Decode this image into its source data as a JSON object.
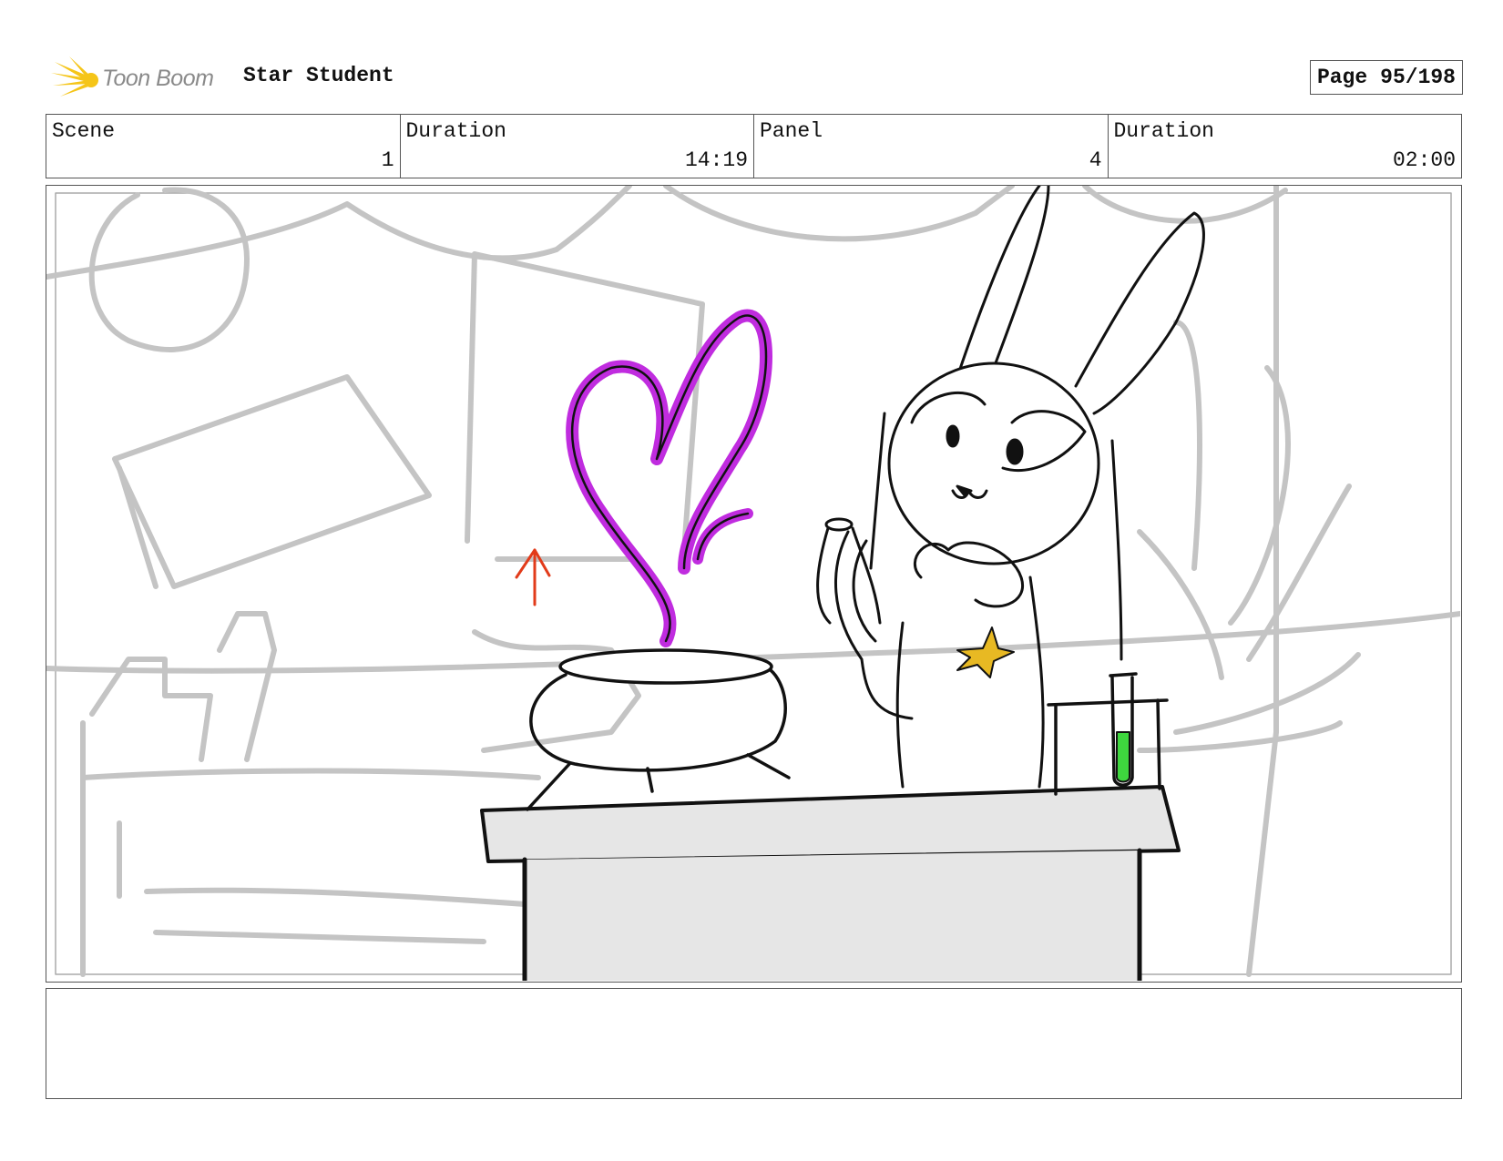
{
  "header": {
    "logo_text": "Toon Boom",
    "project_title": "Star Student",
    "page_label": "Page",
    "page_number": "95/198"
  },
  "info": {
    "scene_label": "Scene",
    "scene_value": "1",
    "scene_duration_label": "Duration",
    "scene_duration_value": "14:19",
    "panel_label": "Panel",
    "panel_value": "4",
    "panel_duration_label": "Duration",
    "panel_duration_value": "02:00"
  },
  "panel_art": {
    "description_icon": "sketch-drawing",
    "colors": {
      "background_sketch": "#c4c4c4",
      "ink": "#111111",
      "heart_smoke": "#c02cdf",
      "arrow": "#e23b1a",
      "star": "#e8b923",
      "liquid": "#3ed63e",
      "desk": "#e6e6e6"
    }
  },
  "notes": {
    "text": ""
  }
}
